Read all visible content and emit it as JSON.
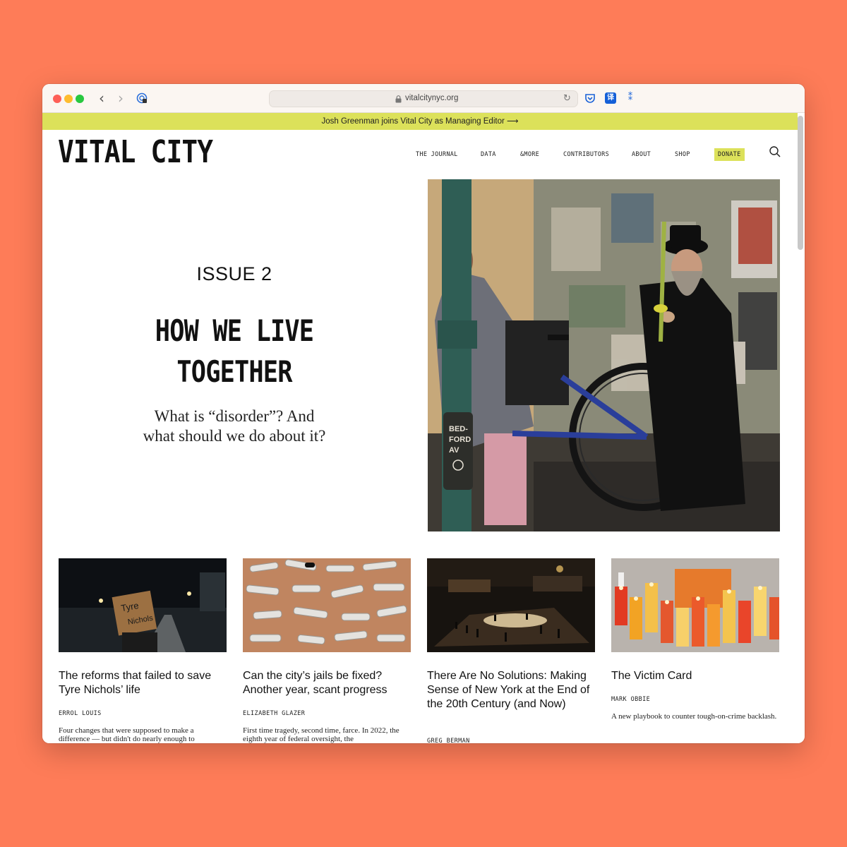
{
  "browser": {
    "url": "vitalcitynyc.org",
    "back_glyph": "‹",
    "forward_glyph": "›",
    "reload_glyph": "↻",
    "translate_ext": "译",
    "stars_ext": "⁑",
    "extensions": [
      "pocket-icon",
      "translate-icon",
      "stars-icon"
    ]
  },
  "banner": {
    "text": "Josh Greenman joins Vital City as Managing Editor ⟶"
  },
  "site": {
    "logo": "VITAL CITY",
    "nav": [
      "THE JOURNAL",
      "DATA",
      "&MORE",
      "CONTRIBUTORS",
      "ABOUT",
      "SHOP",
      "DONATE"
    ],
    "accent_color": "#DCE15A"
  },
  "hero": {
    "issue": "ISSUE 2",
    "title_line1": "HOW WE LIVE",
    "title_line2": "TOGETHER",
    "subtitle_line1": "What is “disorder”? And",
    "subtitle_line2": "what should we do about it?",
    "photo_sign": "BED-\nFORD\nAV"
  },
  "articles": [
    {
      "title": "The reforms that failed to save Tyre Nichols’ life",
      "author": "ERROL LOUIS",
      "description": "Four changes that were supposed to make a difference — but didn't do nearly enough to",
      "image_sign": "Tyre Nichols"
    },
    {
      "title": "Can the city’s jails be fixed? Another year, scant progress",
      "author": "ELIZABETH GLAZER",
      "description": "First time tragedy, second time, farce. In 2022, the eighth year of federal oversight, the"
    },
    {
      "title": "There Are No Solutions: Making Sense of New York at the End of the 20th Century (and Now)",
      "author": "GREG BERMAN",
      "description": ""
    },
    {
      "title": "The Victim Card",
      "author": "MARK OBBIE",
      "description": "A new playbook to counter tough-on-crime backlash."
    }
  ]
}
